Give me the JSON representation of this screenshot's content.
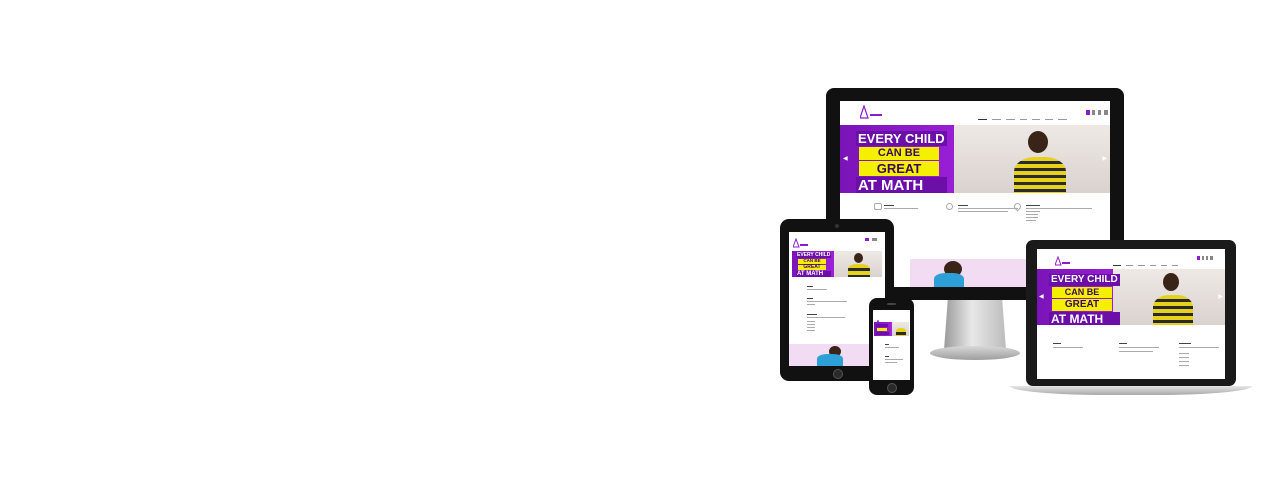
{
  "brand": {
    "colors": {
      "purple": "#8c1bd1",
      "yellow": "#f5f000",
      "lavender": "#f1dcf4",
      "text_dark": "#222222"
    }
  },
  "hero": {
    "line1": "EVERY CHILD",
    "line2": "CAN BE",
    "line3": "GREAT",
    "line4": "AT MATH"
  },
  "icons": [
    "logo-compass-icon",
    "cart-icon",
    "social-icons",
    "slider-prev-arrow",
    "slider-next-arrow",
    "feature-icon"
  ]
}
